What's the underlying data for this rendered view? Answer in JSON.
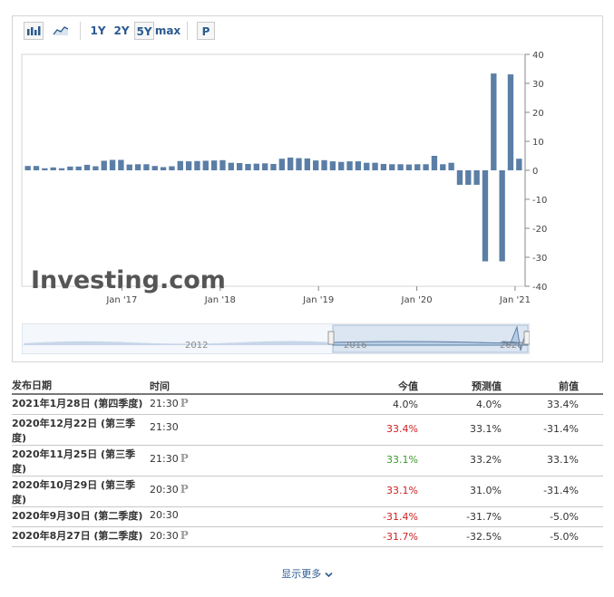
{
  "toolbar": {
    "periods": [
      "1Y",
      "2Y",
      "5Y",
      "max"
    ],
    "selected_period": "5Y",
    "p_button": "P"
  },
  "chart_data": {
    "type": "bar",
    "y_ticks": [
      40,
      30,
      20,
      10,
      0,
      -10,
      -20,
      -30,
      -40
    ],
    "ylim": [
      -40,
      40
    ],
    "x_ticks": [
      "Jan '17",
      "Jan '18",
      "Jan '19",
      "Jan '20",
      "Jan '21"
    ],
    "values": [
      1.5,
      1.5,
      0.7,
      1.0,
      0.7,
      1.3,
      1.3,
      1.9,
      1.4,
      3.3,
      3.6,
      3.6,
      2.0,
      2.1,
      2.1,
      1.5,
      1.1,
      1.4,
      3.2,
      3.1,
      3.2,
      3.3,
      3.4,
      3.5,
      2.6,
      2.5,
      2.2,
      2.3,
      2.4,
      2.2,
      4.0,
      4.4,
      4.2,
      4.1,
      3.4,
      3.5,
      3.1,
      2.9,
      3.1,
      3.1,
      2.6,
      2.6,
      2.2,
      2.1,
      2.1,
      2.0,
      2.1,
      2.1,
      5.0,
      2.1,
      2.6,
      -5.0,
      -5.0,
      -5.0,
      -31.4,
      33.4,
      -31.4,
      33.1,
      4.0
    ],
    "x_start": "2016-01",
    "navigator_labels": [
      "2012",
      "2016",
      "2020"
    ],
    "watermark": "Investing.com",
    "grid": true
  },
  "table": {
    "headers": {
      "date": "发布日期",
      "time": "时间",
      "actual": "今值",
      "forecast": "预测值",
      "previous": "前值"
    },
    "rows": [
      {
        "date_line1": "2021年1月28日 (第四季度)",
        "date_line2": "",
        "time": "21:30",
        "p": "P",
        "actual": "4.0%",
        "actual_color": "neutral",
        "forecast": "4.0%",
        "previous": "33.4%"
      },
      {
        "date_line1": "2020年12月22日 (第三季",
        "date_line2": "度)",
        "time": "21:30",
        "p": "",
        "actual": "33.4%",
        "actual_color": "neg",
        "forecast": "33.1%",
        "previous": "-31.4%"
      },
      {
        "date_line1": "2020年11月25日 (第三季",
        "date_line2": "度)",
        "time": "21:30",
        "p": "P",
        "actual": "33.1%",
        "actual_color": "pos",
        "forecast": "33.2%",
        "previous": "33.1%"
      },
      {
        "date_line1": "2020年10月29日 (第三季",
        "date_line2": "度)",
        "time": "20:30",
        "p": "P",
        "actual": "33.1%",
        "actual_color": "neg",
        "forecast": "31.0%",
        "previous": "-31.4%"
      },
      {
        "date_line1": "2020年9月30日 (第二季度)",
        "date_line2": "",
        "time": "20:30",
        "p": "",
        "actual": "-31.4%",
        "actual_color": "neg",
        "forecast": "-31.7%",
        "previous": "-5.0%"
      },
      {
        "date_line1": "2020年8月27日 (第二季度)",
        "date_line2": "",
        "time": "20:30",
        "p": "P",
        "actual": "-31.7%",
        "actual_color": "neg",
        "forecast": "-32.5%",
        "previous": "-5.0%"
      }
    ]
  },
  "show_more": "显示更多"
}
